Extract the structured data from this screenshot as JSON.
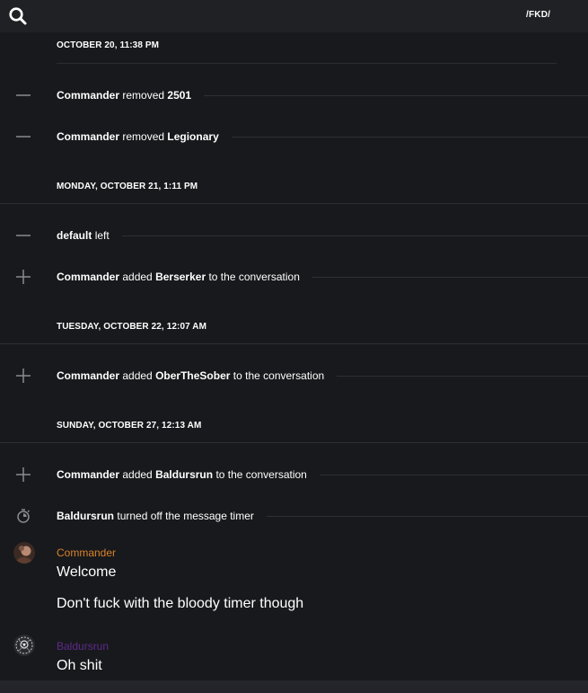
{
  "header": {
    "channel_name": "/FKD/"
  },
  "feed": {
    "first_date": "OCTOBER 20, 11:38 PM",
    "events_1": [
      {
        "actor": "Commander",
        "action": "removed",
        "target": "2501",
        "suffix": ""
      },
      {
        "actor": "Commander",
        "action": "removed",
        "target": "Legionary",
        "suffix": ""
      }
    ],
    "date_2": "MONDAY, OCTOBER 21, 1:11 PM",
    "events_2": [
      {
        "actor": "default",
        "action": "left",
        "target": "",
        "suffix": ""
      },
      {
        "actor": "Commander",
        "action": "added",
        "target": "Berserker",
        "suffix": "to the conversation"
      }
    ],
    "date_3": "TUESDAY, OCTOBER 22, 12:07 AM",
    "events_3": [
      {
        "actor": "Commander",
        "action": "added",
        "target": "OberTheSober",
        "suffix": "to the conversation"
      }
    ],
    "date_4": "SUNDAY, OCTOBER 27, 12:13 AM",
    "events_4": [
      {
        "actor": "Commander",
        "action": "added",
        "target": "Baldursrun",
        "suffix": "to the conversation"
      },
      {
        "actor": "Baldursrun",
        "action": "turned off the message timer",
        "target": "",
        "suffix": ""
      }
    ],
    "messages": [
      {
        "author": "Commander",
        "author_color": "#d9822b",
        "lines": [
          "Welcome",
          "Don't fuck with the bloody timer though"
        ]
      },
      {
        "author": "Baldursrun",
        "author_color": "#5e2a8c",
        "lines": [
          "Oh shit"
        ]
      }
    ]
  },
  "icons": {
    "search": "search-icon",
    "removed": "minus-icon",
    "added": "plus-icon",
    "timer": "timer-icon"
  }
}
